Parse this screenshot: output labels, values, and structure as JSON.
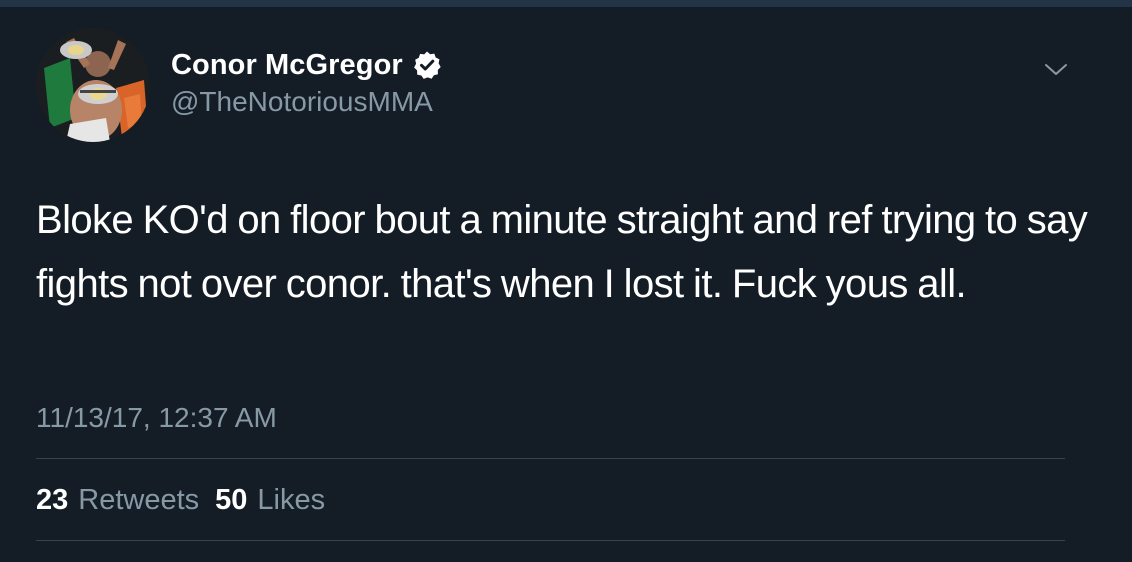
{
  "tweet": {
    "author": {
      "display_name": "Conor McGregor",
      "handle": "@TheNotoriousMMA",
      "verified": true,
      "avatar_icon": "profile-photo"
    },
    "text": "Bloke KO'd on floor bout a minute straight and ref trying to say fights not over conor. that's when I lost it. Fuck yous all.",
    "timestamp": "11/13/17, 12:37 AM",
    "stats": {
      "retweets_count": "23",
      "retweets_label": "Retweets",
      "likes_count": "50",
      "likes_label": "Likes"
    },
    "menu_icon": "chevron-down-icon"
  },
  "colors": {
    "background": "#141d26",
    "secondary_text": "#8899a6",
    "divider": "#38444d",
    "primary_text": "#ffffff"
  }
}
